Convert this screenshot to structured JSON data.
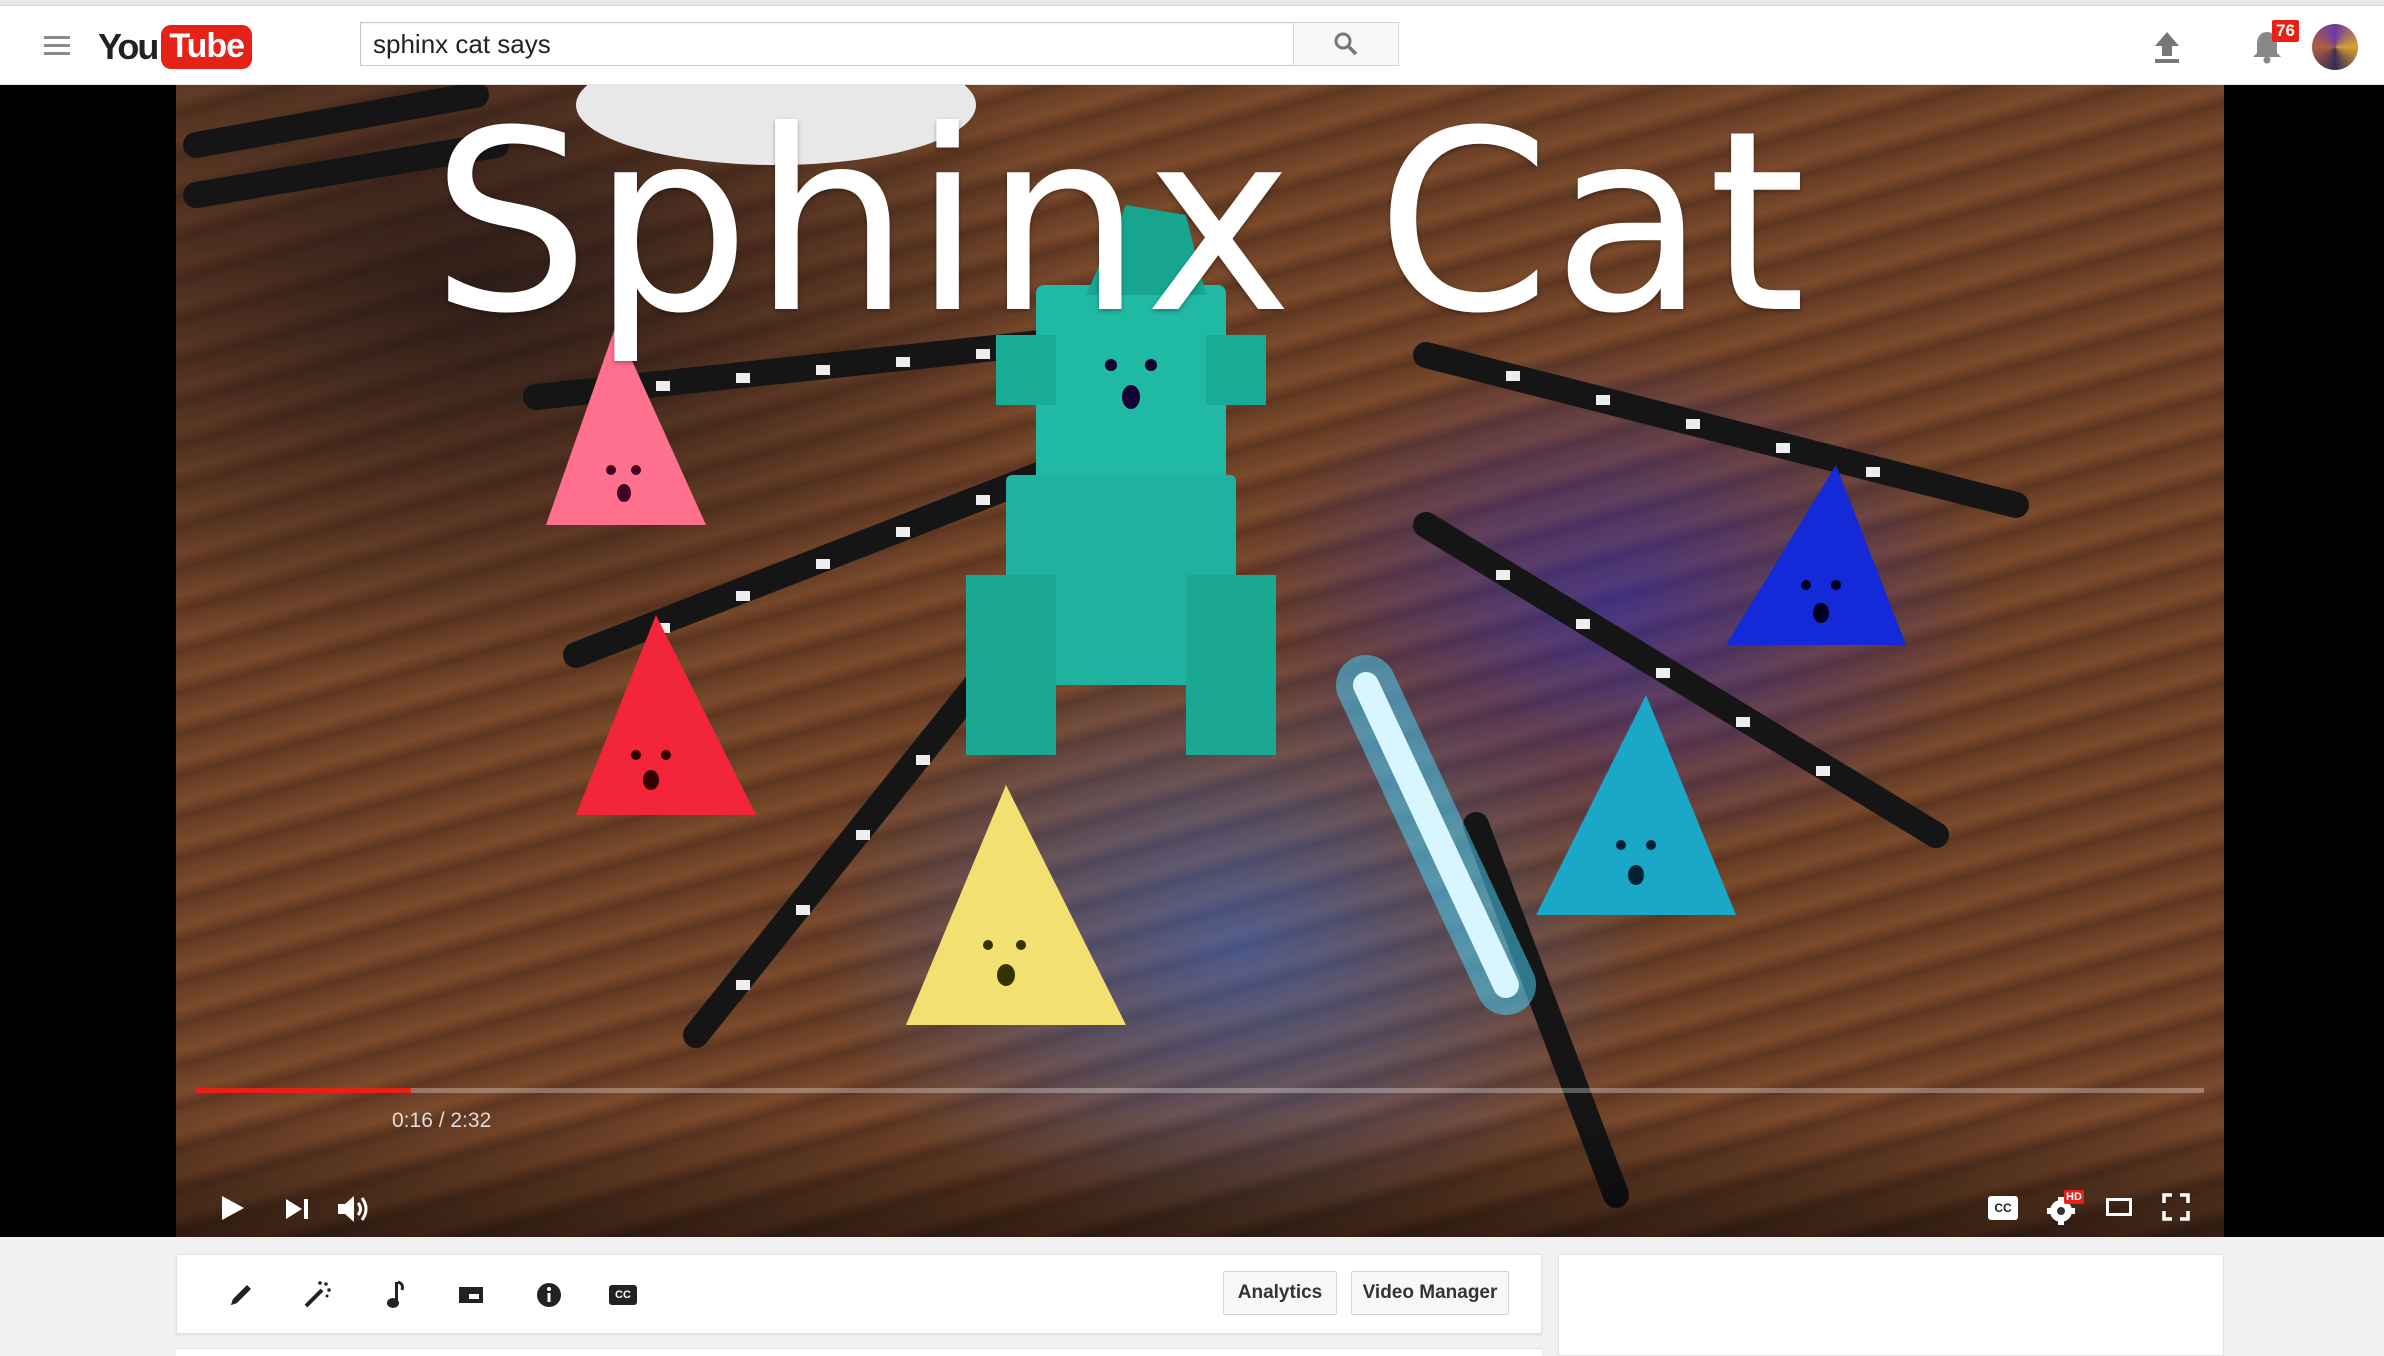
{
  "header": {
    "logo_you": "You",
    "logo_tube": "Tube",
    "search_value": "sphinx cat says",
    "notification_count": "76"
  },
  "video": {
    "overlay_title": "Sphinx Cat",
    "current_time": "0:16",
    "duration": "2:32",
    "time_display": "0:16 / 2:32",
    "progress_fraction": 0.107,
    "hd_badge": "HD",
    "cc_label": "CC"
  },
  "toolbar": {
    "analytics_label": "Analytics",
    "video_manager_label": "Video Manager",
    "cc_label": "CC"
  },
  "colors": {
    "brand_red": "#e62117",
    "player_bg": "#000000"
  }
}
